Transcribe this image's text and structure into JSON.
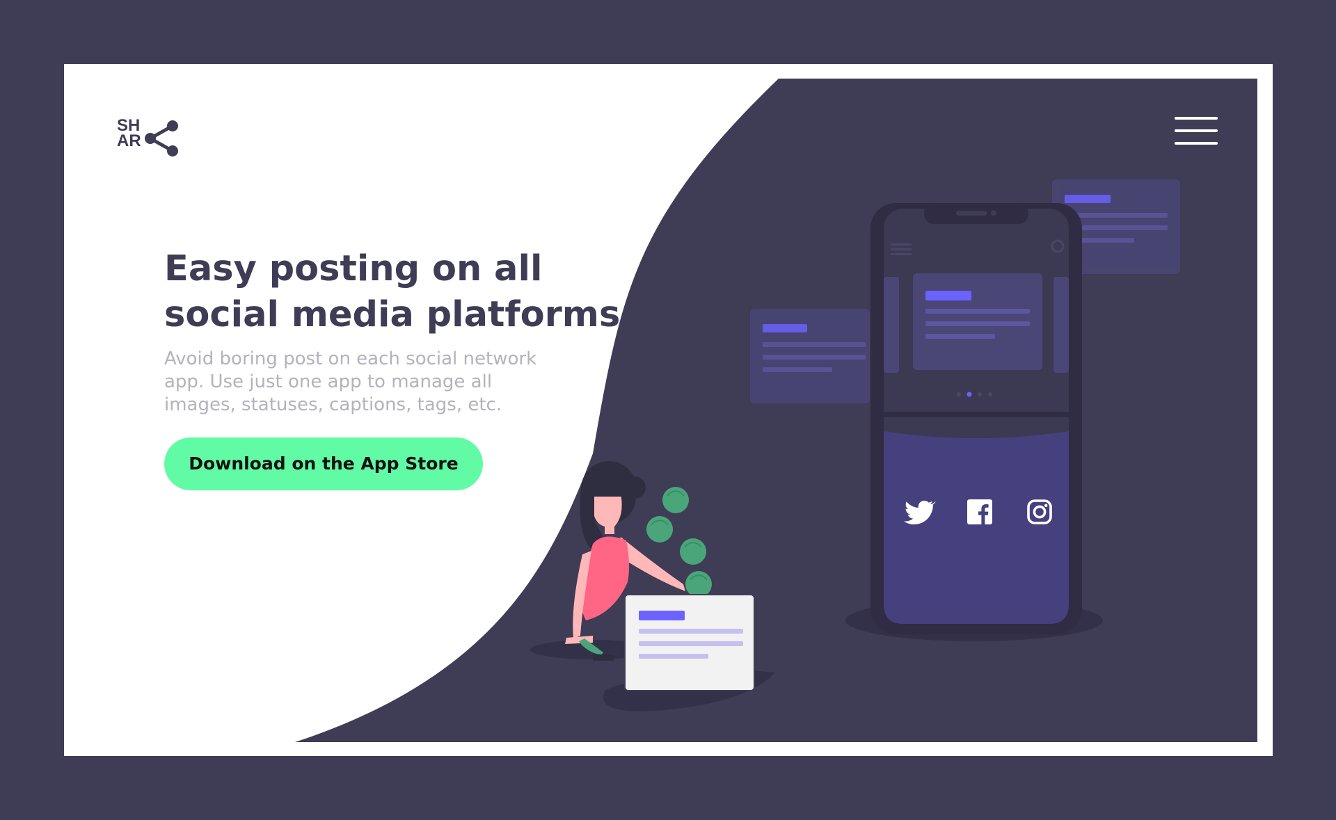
{
  "logo": {
    "text": "SH\nAR",
    "icon": "share-icon"
  },
  "nav": {
    "menu_icon": "hamburger-menu-icon"
  },
  "hero": {
    "headline": "Easy posting on all\nsocial media platforms",
    "description": "Avoid boring post on each social network\napp. Use just one app to manage all\nimages, statuses, captions, tags, etc.",
    "cta_label": "Download on the App Store"
  },
  "phone": {
    "social_icons": [
      "twitter-icon",
      "facebook-icon",
      "instagram-icon"
    ]
  },
  "colors": {
    "background": "#3f3c55",
    "surface": "#ffffff",
    "accent": "#61fba6",
    "brand_purple": "#6c63ff",
    "text_dark": "#3f3c55",
    "text_muted": "#b3b2bd"
  }
}
